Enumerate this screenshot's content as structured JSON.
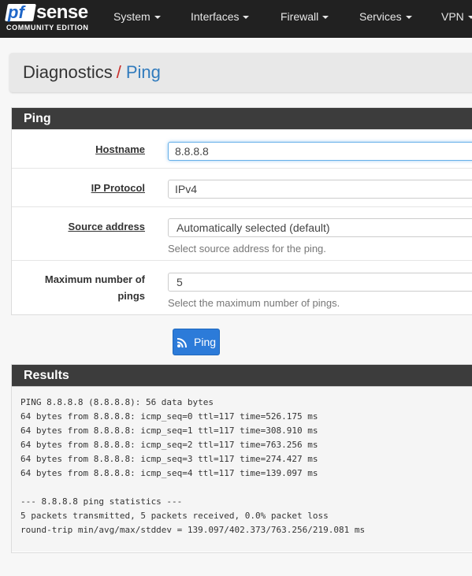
{
  "brand": {
    "logo_pf": "pf",
    "logo_sense": "sense",
    "edition": "COMMUNITY EDITION"
  },
  "nav": [
    {
      "label": "System"
    },
    {
      "label": "Interfaces"
    },
    {
      "label": "Firewall"
    },
    {
      "label": "Services"
    },
    {
      "label": "VPN"
    }
  ],
  "breadcrumb": {
    "parent": "Diagnostics",
    "separator": "/",
    "current": "Ping"
  },
  "ping_panel": {
    "title": "Ping",
    "hostname": {
      "label": "Hostname",
      "value": "8.8.8.8"
    },
    "ip_protocol": {
      "label": "IP Protocol",
      "value": "IPv4"
    },
    "source_address": {
      "label": "Source address",
      "value": "Automatically selected (default)",
      "help": "Select source address for the ping."
    },
    "max_pings": {
      "label_line1": "Maximum number of",
      "label_line2": "pings",
      "value": "5",
      "help": "Select the maximum number of pings."
    }
  },
  "ping_button": {
    "label": "Ping",
    "icon": "rss-icon",
    "color": "#2c7bd9"
  },
  "results": {
    "title": "Results",
    "lines": [
      "PING 8.8.8.8 (8.8.8.8): 56 data bytes",
      "64 bytes from 8.8.8.8: icmp_seq=0 ttl=117 time=526.175 ms",
      "64 bytes from 8.8.8.8: icmp_seq=1 ttl=117 time=308.910 ms",
      "64 bytes from 8.8.8.8: icmp_seq=2 ttl=117 time=763.256 ms",
      "64 bytes from 8.8.8.8: icmp_seq=3 ttl=117 time=274.427 ms",
      "64 bytes from 8.8.8.8: icmp_seq=4 ttl=117 time=139.097 ms",
      "",
      "--- 8.8.8.8 ping statistics ---",
      "5 packets transmitted, 5 packets received, 0.0% packet loss",
      "round-trip min/avg/max/stddev = 139.097/402.373/763.256/219.081 ms"
    ]
  },
  "colors": {
    "navbar": "#212121",
    "panel_heading": "#3c3c3c",
    "link": "#317bbd",
    "separator": "#c9302c"
  }
}
